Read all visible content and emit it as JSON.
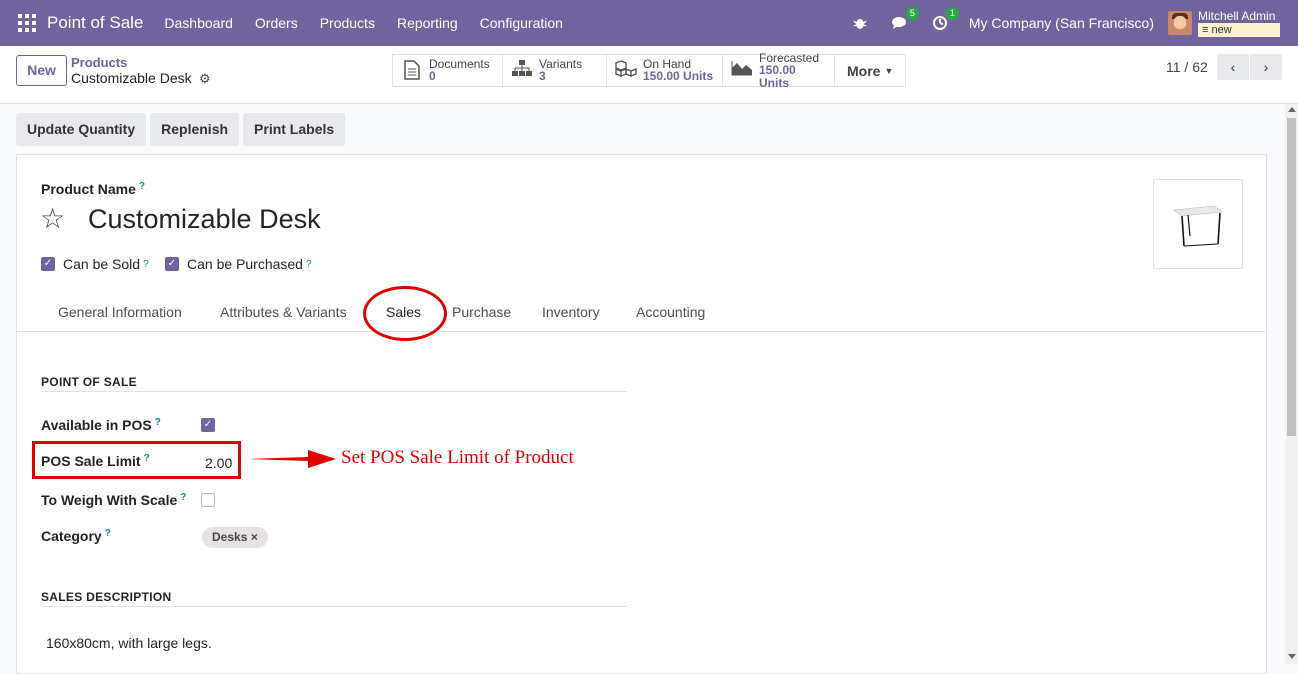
{
  "navbar": {
    "app_name": "Point of Sale",
    "menu": [
      "Dashboard",
      "Orders",
      "Products",
      "Reporting",
      "Configuration"
    ],
    "messages_count": "5",
    "activities_count": "1",
    "company": "My Company (San Francisco)",
    "user_name": "Mitchell Admin",
    "database": "new"
  },
  "control": {
    "new_label": "New",
    "breadcrumb_parent": "Products",
    "breadcrumb_current": "Customizable Desk",
    "smart_buttons": [
      {
        "label": "Documents",
        "value": "0",
        "icon": "document-icon"
      },
      {
        "label": "Variants",
        "value": "3",
        "icon": "sitemap-icon"
      },
      {
        "label": "On Hand",
        "value": "150.00 Units",
        "icon": "cubes-icon"
      },
      {
        "label": "Forecasted",
        "value": "150.00 Units",
        "icon": "area-chart-icon"
      }
    ],
    "more_label": "More",
    "pager": "11 / 62"
  },
  "actions": [
    "Update Quantity",
    "Replenish",
    "Print Labels"
  ],
  "form": {
    "product_name_label": "Product Name",
    "product_name": "Customizable Desk",
    "can_be_sold_label": "Can be Sold",
    "can_be_purchased_label": "Can be Purchased",
    "tabs": [
      "General Information",
      "Attributes & Variants",
      "Sales",
      "Purchase",
      "Inventory",
      "Accounting"
    ],
    "active_tab": "Sales",
    "pos_section_title": "POINT OF SALE",
    "available_in_pos_label": "Available in POS",
    "pos_sale_limit_label": "POS Sale Limit",
    "pos_sale_limit_value": "2.00",
    "to_weigh_label": "To Weigh With Scale",
    "category_label": "Category",
    "category_tag": "Desks",
    "sales_desc_title": "SALES DESCRIPTION",
    "sales_description": "160x80cm, with large legs."
  },
  "annotation": {
    "text": "Set POS Sale Limit of Product",
    "color": "#e00000"
  },
  "colors": {
    "brand": "#71639e",
    "badge": "#28a745"
  }
}
